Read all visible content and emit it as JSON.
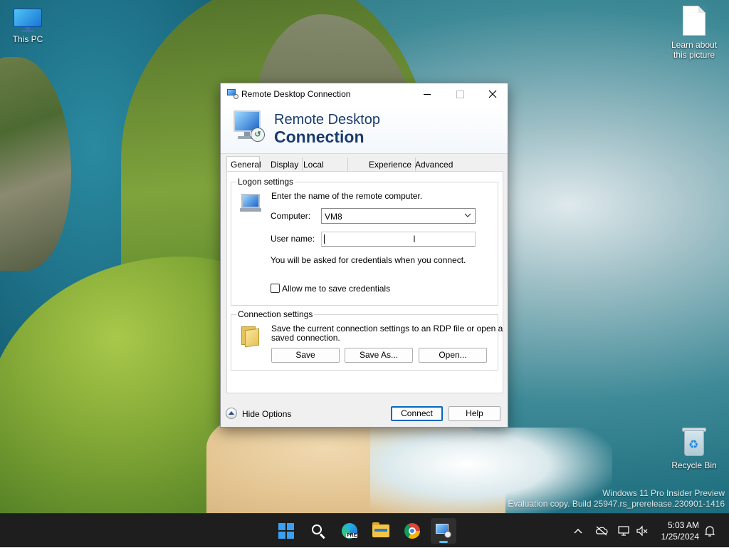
{
  "desktop": {
    "icons": {
      "this_pc": "This PC",
      "learn_picture": "Learn about this picture",
      "recycle_bin": "Recycle Bin"
    },
    "watermark": {
      "line1": "Windows 11 Pro Insider Preview",
      "line2": "Evaluation copy. Build 25947.rs_prerelease.230901-1416"
    }
  },
  "window": {
    "title": "Remote Desktop Connection",
    "banner_line1": "Remote Desktop",
    "banner_line2": "Connection",
    "tabs": [
      {
        "label": "General",
        "selected": true
      },
      {
        "label": "Display"
      },
      {
        "label": "Local Resources"
      },
      {
        "label": "Experience"
      },
      {
        "label": "Advanced"
      }
    ],
    "logon": {
      "group_title": "Logon settings",
      "instruction": "Enter the name of the remote computer.",
      "computer_label": "Computer:",
      "computer_value": "VM8",
      "username_label": "User name:",
      "username_value": "",
      "credentials_note": "You will be asked for credentials when you connect.",
      "save_credentials_label": "Allow me to save credentials",
      "save_credentials_checked": false
    },
    "connection": {
      "group_title": "Connection settings",
      "description_line1": "Save the current connection settings to an RDP file or open a",
      "description_line2": "saved connection.",
      "save_button": "Save",
      "save_as_button": "Save As...",
      "open_button": "Open..."
    },
    "footer": {
      "hide_options": "Hide Options",
      "connect_button": "Connect",
      "help_button": "Help"
    }
  },
  "taskbar": {
    "apps": [
      "start-icon",
      "search-icon",
      "edge-dev-icon",
      "file-explorer-icon",
      "chrome-icon",
      "remote-desktop-icon"
    ],
    "edge_badge": "PRE",
    "clock_time": "5:03 AM",
    "clock_date": "1/25/2024"
  },
  "colors": {
    "taskbar_bg": "#1e1e1e",
    "accent": "#0067c0",
    "banner_text": "#1a3c6e"
  }
}
